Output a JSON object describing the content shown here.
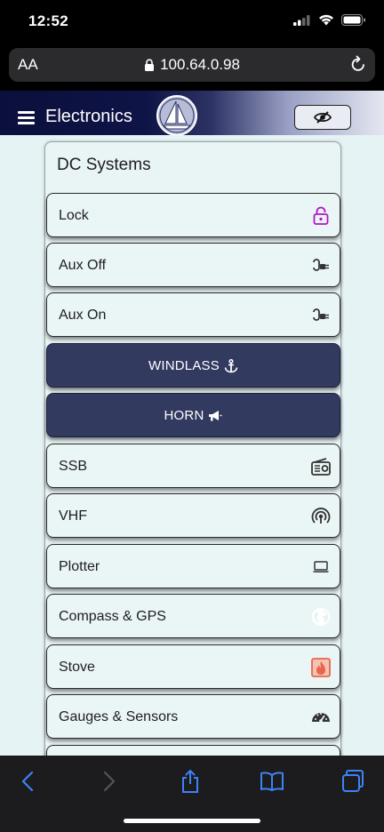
{
  "status_bar": {
    "time": "12:52"
  },
  "browser": {
    "text_size_label": "AA",
    "url": "100.64.0.98"
  },
  "header": {
    "title": "Electronics"
  },
  "panel": {
    "title": "DC Systems",
    "items": [
      {
        "label": "Lock",
        "icon": "lock-open-icon",
        "style": "light"
      },
      {
        "label": "Aux Off",
        "icon": "plug-icon",
        "style": "light"
      },
      {
        "label": "Aux On",
        "icon": "plug-icon",
        "style": "light"
      },
      {
        "label": "WINDLASS",
        "icon": "anchor-icon",
        "style": "dark"
      },
      {
        "label": "HORN",
        "icon": "bullhorn-icon",
        "style": "dark"
      },
      {
        "label": "SSB",
        "icon": "radio-icon",
        "style": "light"
      },
      {
        "label": "VHF",
        "icon": "broadcast-icon",
        "style": "light"
      },
      {
        "label": "Plotter",
        "icon": "laptop-icon",
        "style": "light"
      },
      {
        "label": "Compass & GPS",
        "icon": "globe-icon",
        "style": "light"
      },
      {
        "label": "Stove",
        "icon": "fire-icon",
        "style": "light"
      },
      {
        "label": "Gauges & Sensors",
        "icon": "gauge-icon",
        "style": "light"
      }
    ]
  },
  "colors": {
    "accent_dark": "#323a60",
    "lock_icon": "#b215c8",
    "stove_icon": "#e8664c",
    "background": "#e6f3f5"
  }
}
